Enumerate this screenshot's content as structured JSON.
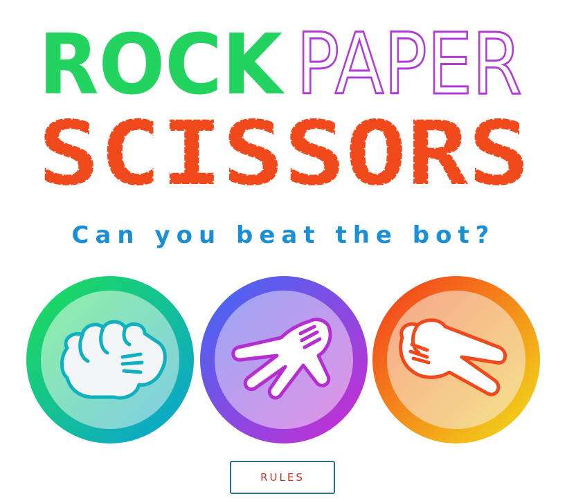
{
  "logo": {
    "word_rock": "ROCK",
    "word_paper": "PAPER",
    "word_scissors": "SCISSORS"
  },
  "tagline": "Can you beat the bot?",
  "choices": [
    {
      "name": "rock",
      "icon": "fist-icon"
    },
    {
      "name": "paper",
      "icon": "open-hand-icon"
    },
    {
      "name": "scissors",
      "icon": "scissors-hand-icon"
    }
  ],
  "rules_button": "RULES",
  "colors": {
    "rock_word": "#22d45f",
    "paper_word": "#b03bd6",
    "scissors_word": "#f04a1c",
    "tagline": "#1b8fd6",
    "rules_text": "#c0392b",
    "rules_border": "#2e6f8e",
    "rock_ring": [
      "#1de053",
      "#0aa0d8"
    ],
    "paper_ring": [
      "#3a6cf5",
      "#d02ad0"
    ],
    "scissors_ring": [
      "#f5361b",
      "#f2e21a"
    ]
  }
}
